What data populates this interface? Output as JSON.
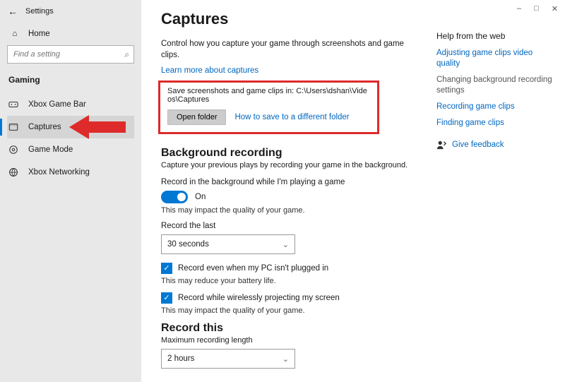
{
  "app": {
    "title": "Settings",
    "home": "Home"
  },
  "search": {
    "placeholder": "Find a setting"
  },
  "section": "Gaming",
  "nav": {
    "xbox_game_bar": "Xbox Game Bar",
    "captures": "Captures",
    "game_mode": "Game Mode",
    "xbox_networking": "Xbox Networking"
  },
  "page": {
    "title": "Captures",
    "intro": "Control how you capture your game through screenshots and game clips.",
    "learn_more": "Learn more about captures",
    "save_path_label": "Save screenshots and game clips in: C:\\Users\\dshan\\Videos\\Captures",
    "open_folder": "Open folder",
    "how_diff_folder": "How to save to a different folder",
    "bg_heading": "Background recording",
    "bg_sub": "Capture your previous plays by recording your game in the background.",
    "bg_toggle_label": "Record in the background while I'm playing a game",
    "bg_toggle_state": "On",
    "bg_impact": "This may impact the quality of your game.",
    "record_last_label": "Record the last",
    "record_last_value": "30 seconds",
    "chk_plugged": "Record even when my PC isn't plugged in",
    "chk_plugged_note": "This may reduce your battery life.",
    "chk_wireless": "Record while wirelessly projecting my screen",
    "chk_wireless_note": "This may impact the quality of your game.",
    "record_this_heading": "Record this",
    "max_len_label": "Maximum recording length",
    "max_len_value": "2 hours"
  },
  "help": {
    "title": "Help from the web",
    "adjust_quality": "Adjusting game clips video quality",
    "change_bg": "Changing background recording settings",
    "recording_clips": "Recording game clips",
    "finding_clips": "Finding game clips",
    "give_feedback": "Give feedback"
  }
}
